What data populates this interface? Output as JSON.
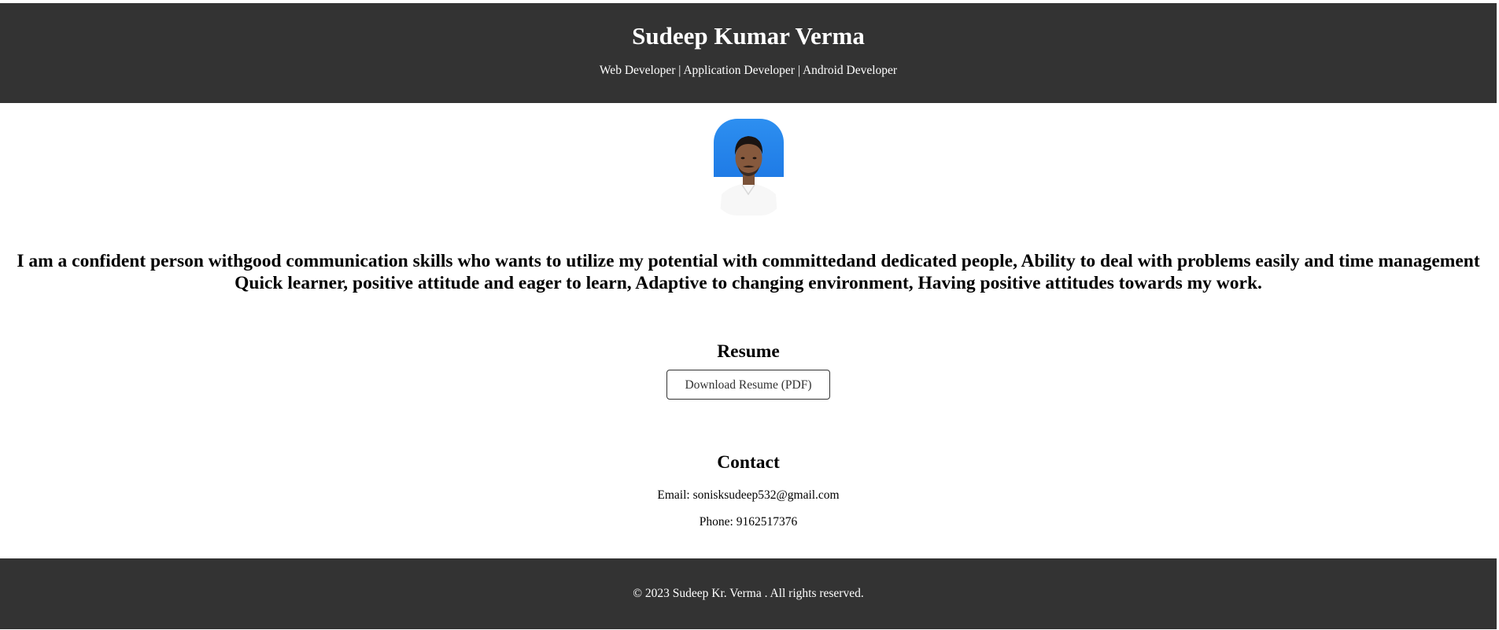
{
  "header": {
    "name": "Sudeep Kumar Verma",
    "roles": "Web Developer | Application Developer | Android Developer"
  },
  "bio": "I am a confident person withgood communication skills who wants to utilize my potential with committedand dedicated people, Ability to deal with problems easily and time management Quick learner, positive attitude and eager to learn, Adaptive to changing environment, Having positive attitudes towards my work.",
  "resume": {
    "title": "Resume",
    "button_label": "Download Resume (PDF)"
  },
  "contact": {
    "title": "Contact",
    "email": "Email: sonisksudeep532@gmail.com",
    "phone": "Phone: 9162517376"
  },
  "footer": {
    "copyright": "© 2023 Sudeep Kr. Verma . All rights reserved."
  },
  "colors": {
    "header_bg": "#333333",
    "footer_bg": "#333333",
    "avatar_bg": "#2d8ff0"
  }
}
